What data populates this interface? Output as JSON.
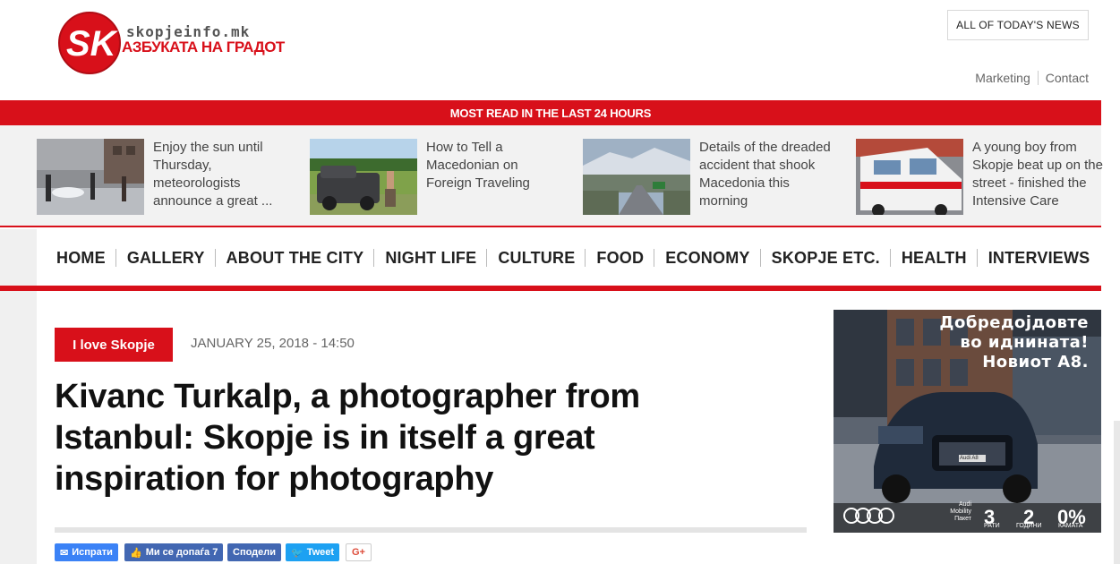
{
  "header": {
    "logo_site": "skopjeinfo.mk",
    "logo_tagline": "АЗБУКАТА НА ГРАДОТ",
    "todays_news_label": "ALL OF TODAY'S NEWS",
    "links": [
      "Marketing",
      "Contact"
    ]
  },
  "most_read": {
    "heading": "MOST READ IN THE LAST 24 HOURS",
    "items": [
      {
        "title": "Enjoy the sun until Thursday, meteorologists announce a great ..."
      },
      {
        "title": "How to Tell a Macedonian on Foreign Traveling"
      },
      {
        "title": "Details of the dreaded accident that shook Macedonia this morning"
      },
      {
        "title": "A young boy from Skopje beat up on the street - finished the Intensive Care"
      }
    ]
  },
  "nav": {
    "items": [
      "HOME",
      "GALLERY",
      "ABOUT THE CITY",
      "NIGHT LIFE",
      "CULTURE",
      "FOOD",
      "ECONOMY",
      "SKOPJE ETC.",
      "HEALTH",
      "INTERVIEWS"
    ]
  },
  "article": {
    "category": "I love Skopje",
    "date": "JANUARY 25, 2018 - 14:50",
    "headline": "Kivanc Turkalp, a photographer from Istanbul: Skopje is in itself a great inspiration for photography"
  },
  "share": {
    "messenger": "Испрати",
    "like": "Ми се допаѓа 7",
    "share": "Сподели",
    "tweet": "Tweet",
    "gplus": "G+"
  },
  "ad": {
    "line1": "Добредојдовте",
    "line2": "во иднината!",
    "line3": "Новиот А8.",
    "model_plate": "Audi A8",
    "package_label": "Audi Mobility Пакет",
    "years_value": "3",
    "years_label": "РАТИ",
    "terms_value": "2",
    "terms_label": "ГОДИНИ",
    "rate_value": "0%",
    "rate_label": "КАМАТА"
  },
  "colors": {
    "brand_red": "#d8101a",
    "facebook_blue": "#4267b2",
    "twitter_blue": "#1da1f2"
  }
}
